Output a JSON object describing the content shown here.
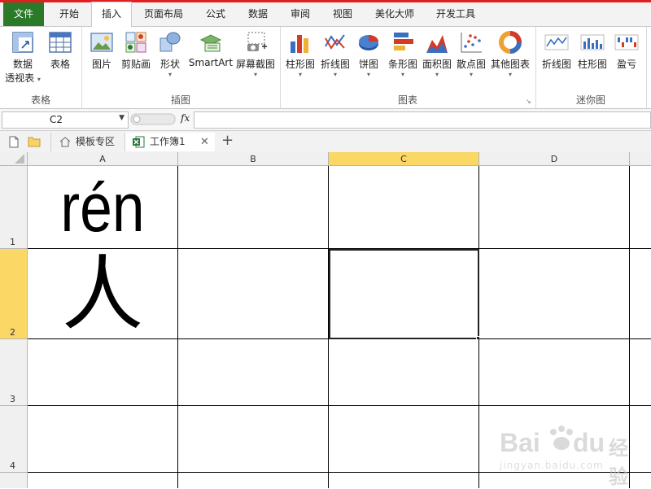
{
  "tabs": [
    "文件",
    "开始",
    "插入",
    "页面布局",
    "公式",
    "数据",
    "审阅",
    "视图",
    "美化大师",
    "开发工具"
  ],
  "active_tab": "插入",
  "ribbon": {
    "groups": {
      "table": {
        "label": "表格",
        "pivot_line1": "数据",
        "pivot_line2": "透视表",
        "table": "表格"
      },
      "illustration": {
        "label": "插图",
        "picture": "图片",
        "clipart": "剪贴画",
        "shapes": "形状",
        "smartart": "SmartArt",
        "screenshot": "屏幕截图"
      },
      "charts": {
        "label": "图表",
        "column": "柱形图",
        "line": "折线图",
        "pie": "饼图",
        "bar": "条形图",
        "area": "面积图",
        "scatter": "散点图",
        "other": "其他图表"
      },
      "sparklines": {
        "label": "迷你图",
        "line": "折线图",
        "column": "柱形图",
        "winloss": "盈亏"
      }
    }
  },
  "formula_bar": {
    "name_box": "C2",
    "fx": "fx",
    "content": ""
  },
  "doc_tabs": {
    "template": "模板专区",
    "workbook": "工作簿1",
    "add": "+"
  },
  "sheet": {
    "columns": [
      "A",
      "B",
      "C",
      "D"
    ],
    "rows": [
      "1",
      "2",
      "3",
      "4"
    ],
    "selected_cell": "C2",
    "cells": {
      "A1": "rén",
      "A2": "人"
    }
  },
  "watermark": {
    "text": "经验",
    "url_text": "jingyan.baidu.com"
  }
}
